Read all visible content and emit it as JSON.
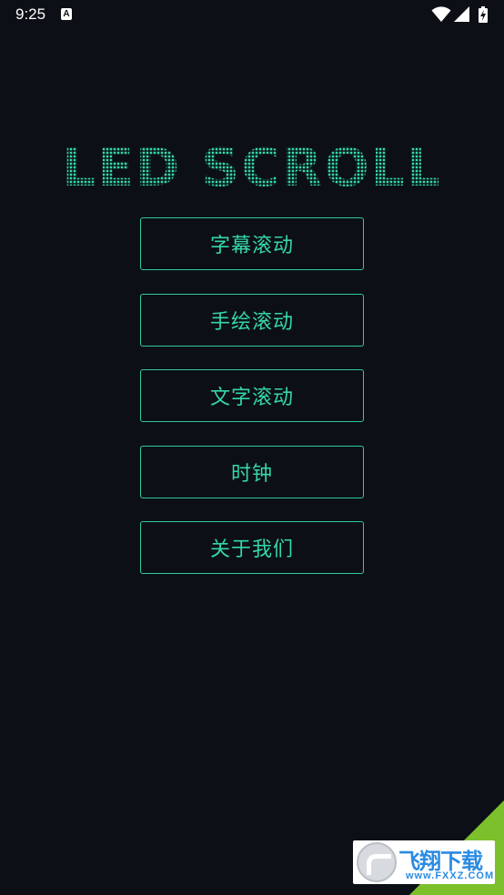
{
  "status_bar": {
    "time": "9:25",
    "notification_icon": "a-icon",
    "icons": [
      "wifi-icon",
      "cell-signal-icon",
      "battery-charging-icon"
    ]
  },
  "app": {
    "title": "LED SCROLL",
    "accent_color": "#35d6aa",
    "background_color": "#0c1016"
  },
  "menu": {
    "items": [
      {
        "label": "字幕滚动"
      },
      {
        "label": "手绘滚动"
      },
      {
        "label": "文字滚动"
      },
      {
        "label": "时钟"
      },
      {
        "label": "关于我们"
      }
    ]
  },
  "watermark": {
    "brand": "飞翔下载",
    "domain": "www.FXXZ.COM",
    "color": "#7cc02c"
  }
}
